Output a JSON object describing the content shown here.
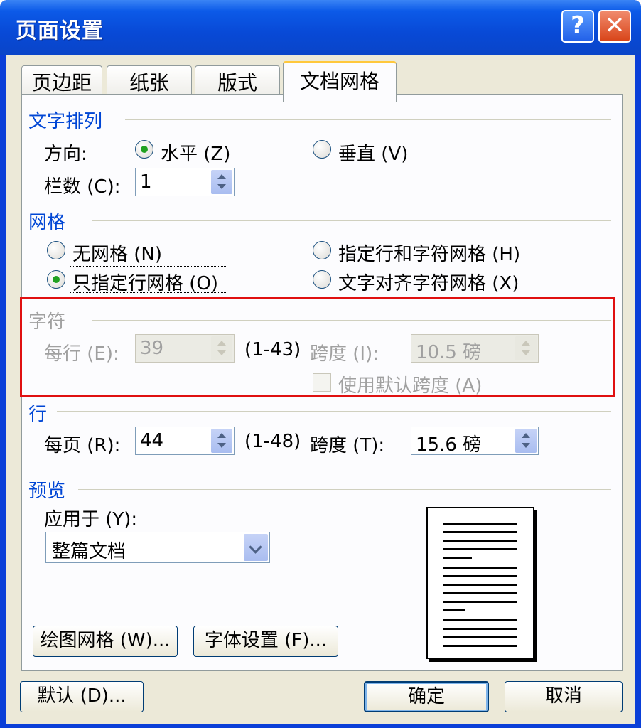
{
  "window": {
    "title": "页面设置",
    "help_label": "?",
    "close_label": "✕"
  },
  "tabs": [
    {
      "label": "页边距"
    },
    {
      "label": "纸张"
    },
    {
      "label": "版式"
    },
    {
      "label": "文档网格"
    }
  ],
  "text_layout": {
    "group_label": "文字排列",
    "direction_label": "方向:",
    "horizontal_label": "水平 (Z)",
    "vertical_label": "垂直 (V)",
    "columns_label": "栏数 (C):",
    "columns_value": "1"
  },
  "grid": {
    "group_label": "网格",
    "no_grid": "无网格 (N)",
    "line_char_grid": "指定行和字符网格 (H)",
    "line_grid_only": "只指定行网格 (O)",
    "snap_char_grid": "文字对齐字符网格 (X)",
    "selected": "line_grid_only"
  },
  "characters": {
    "group_label": "字符",
    "per_line_label": "每行 (E):",
    "per_line_value": "39",
    "per_line_range": "(1-43)",
    "pitch_label": "跨度 (I):",
    "pitch_value": "10.5 磅",
    "use_default_pitch_label": "使用默认跨度 (A)"
  },
  "lines": {
    "group_label": "行",
    "per_page_label": "每页 (R):",
    "per_page_value": "44",
    "per_page_range": "(1-48)",
    "pitch_label": "跨度 (T):",
    "pitch_value": "15.6 磅"
  },
  "preview": {
    "group_label": "预览",
    "apply_to_label": "应用于 (Y):",
    "apply_to_value": "整篇文档"
  },
  "buttons": {
    "draw_grid": "绘图网格 (W)...",
    "font_settings": "字体设置 (F)...",
    "default": "默认 (D)...",
    "ok": "确定",
    "cancel": "取消"
  },
  "colors": {
    "group_label": "#0046d5",
    "highlight_box": "#e01010",
    "title_bar": "#0849d6",
    "dialog_face": "#ece9d8"
  }
}
